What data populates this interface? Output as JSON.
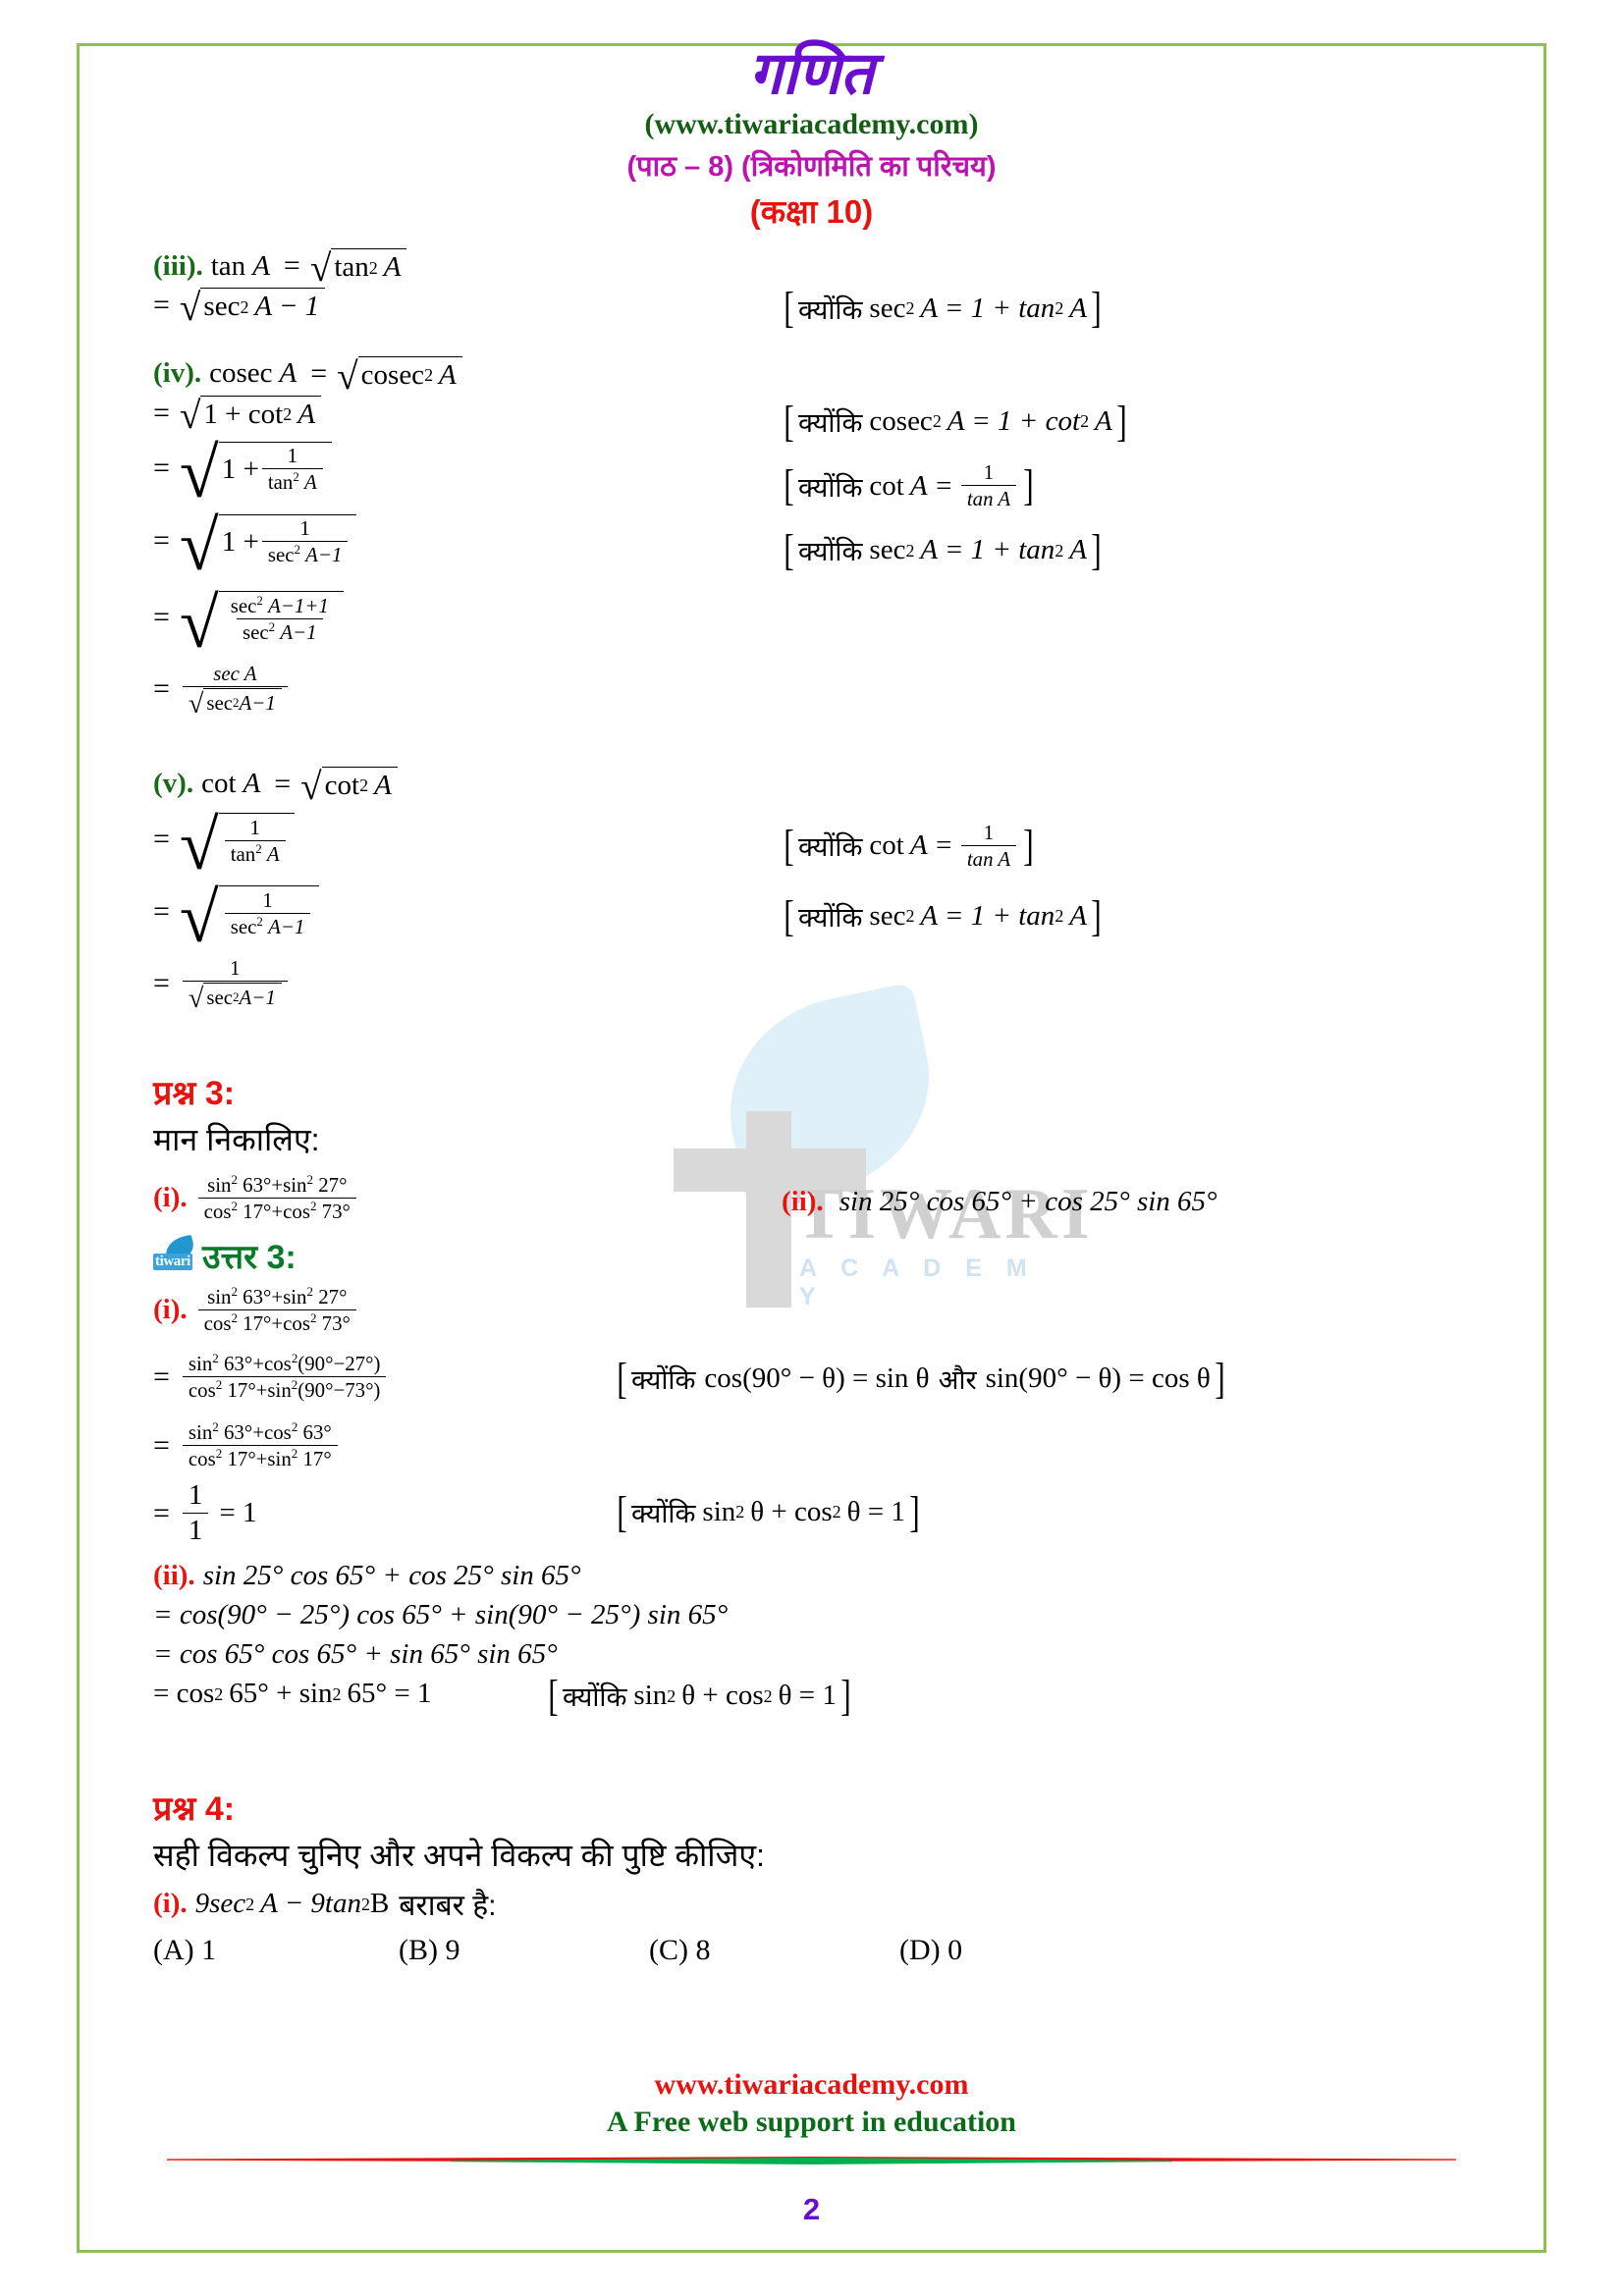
{
  "header": {
    "title": "गणित",
    "site": "(www.tiwariacademy.com)",
    "chapter": "(पाठ – 8) (त्रिकोणमिति का परिचय)",
    "klass": "(कक्षा 10)"
  },
  "watermark": {
    "word": "TIWARI",
    "sub": "A C A D E M Y"
  },
  "colors": {
    "title_purple": "#6a0dd0",
    "site_green": "#155d15",
    "chapter_magenta": "#bc13b0",
    "class_red": "#e8130f",
    "label_green": "#186a18",
    "answer_green": "#0a7a2a",
    "border_green": "#8cc152"
  },
  "part_iii": {
    "label": "(iii).",
    "line1_lhs": "tan",
    "line1_var": "A",
    "line1_eq": "=",
    "line1_rad_fn": "tan",
    "line1_rad_sup": "2",
    "line1_rad_var": "A",
    "line2_eq": "=",
    "line2_rad_fn": "sec",
    "line2_rad_sup": "2",
    "line2_rad_rest": "A − 1",
    "note": {
      "because": "क्योंकि",
      "fn": "sec",
      "sup": "2",
      "body": "A = 1 + tan",
      "sup2": "2",
      "tail": "A"
    }
  },
  "part_iv": {
    "label": "(iv).",
    "line1_lhs": "cosec",
    "line1_var": "A",
    "line1_eq": "=",
    "line1_rad_fn": "cosec",
    "line1_rad_sup": "2",
    "line1_rad_var": "A",
    "line2_eq": "=",
    "line2_radicand": "1 + cot",
    "line2_sup": "2",
    "line2_tail": "A",
    "line3_eq": "=",
    "line3_one": "1 +",
    "line3_num": "1",
    "line3_den_fn": "tan",
    "line3_den_sup": "2",
    "line3_den_var": "A",
    "line4_eq": "=",
    "line4_one": "1 +",
    "line4_num": "1",
    "line4_den_fn": "sec",
    "line4_den_sup": "2",
    "line4_den_rest": "A−1",
    "line5_eq": "=",
    "line5_num_fn": "sec",
    "line5_num_sup": "2",
    "line5_num_rest": "A−1+1",
    "line5_den_fn": "sec",
    "line5_den_sup": "2",
    "line5_den_rest": "A−1",
    "line6_eq": "=",
    "line6_num": "sec A",
    "line6_den_fn": "sec",
    "line6_den_sup": "2",
    "line6_den_rest": "A−1",
    "note1": {
      "because": "क्योंकि",
      "fn": "cosec",
      "sup": "2",
      "body": "A = 1 + cot",
      "sup2": "2",
      "tail": "A"
    },
    "note2": {
      "because": "क्योंकि",
      "fn": "cot",
      "body": "A =",
      "num": "1",
      "den": "tan A"
    },
    "note3": {
      "because": "क्योंकि",
      "fn": "sec",
      "sup": "2",
      "body": "A = 1 + tan",
      "sup2": "2",
      "tail": "A"
    }
  },
  "part_v": {
    "label": "(v).",
    "line1_lhs": "cot",
    "line1_var": "A",
    "line1_eq": "=",
    "line1_rad_fn": "cot",
    "line1_rad_sup": "2",
    "line1_rad_var": "A",
    "line2_eq": "=",
    "line2_num": "1",
    "line2_den_fn": "tan",
    "line2_den_sup": "2",
    "line2_den_var": "A",
    "line3_eq": "=",
    "line3_num": "1",
    "line3_den_fn": "sec",
    "line3_den_sup": "2",
    "line3_den_rest": "A−1",
    "line4_eq": "=",
    "line4_num": "1",
    "line4_den_fn": "sec",
    "line4_den_sup": "2",
    "line4_den_rest": "A−1",
    "note1": {
      "because": "क्योंकि",
      "fn": "cot",
      "body": "A =",
      "num": "1",
      "den": "tan A"
    },
    "note2": {
      "because": "क्योंकि",
      "fn": "sec",
      "sup": "2",
      "body": "A = 1 + tan",
      "sup2": "2",
      "tail": "A"
    }
  },
  "question3": {
    "heading": "प्रश्न 3:",
    "prompt": "मान निकालिए:",
    "i_label": "(i).",
    "i_num": "sin",
    "i_num_sup": "2",
    "i_num_a": "63°+sin",
    "i_num_sup2": "2",
    "i_num_b": "27°",
    "i_den": "cos",
    "i_den_sup": "2",
    "i_den_a": "17°+cos",
    "i_den_sup2": "2",
    "i_den_b": "73°",
    "ii_label": "(ii).",
    "ii_text": "sin 25° cos 65° + cos 25° sin 65°"
  },
  "answer3": {
    "heading": "उत्तर 3:",
    "i_label": "(i).",
    "step1_num": "sin",
    "step1_num_sup": "2",
    "step1_num_a": "63°+sin",
    "step1_num_sup2": "2",
    "step1_num_b": "27°",
    "step1_den": "cos",
    "step1_den_sup": "2",
    "step1_den_a": "17°+cos",
    "step1_den_sup2": "2",
    "step1_den_b": "73°",
    "step2_eq": "=",
    "step2_num": "sin",
    "step2_num_sup": "2",
    "step2_num_a": "63°+cos",
    "step2_num_sup2": "2",
    "step2_num_b": "(90°−27°)",
    "step2_den": "cos",
    "step2_den_sup": "2",
    "step2_den_a": "17°+sin",
    "step2_den_sup2": "2",
    "step2_den_b": "(90°−73°)",
    "step3_eq": "=",
    "step3_num": "sin",
    "step3_num_sup": "2",
    "step3_num_a": "63°+cos",
    "step3_num_sup2": "2",
    "step3_num_b": "63°",
    "step3_den": "cos",
    "step3_den_sup": "2",
    "step3_den_a": "17°+sin",
    "step3_den_sup2": "2",
    "step3_den_b": "17°",
    "step4_eq": "=",
    "step4_num": "1",
    "step4_den": "1",
    "step4_tail": "= 1",
    "note_a": {
      "because": "क्योंकि",
      "body1": "cos(90° − θ) = sin θ",
      "and": "और",
      "body2": "sin(90° − θ) = cos θ"
    },
    "note_b": {
      "because": "क्योंकि",
      "fn": "sin",
      "sup": "2",
      "mid": "θ + cos",
      "sup2": "2",
      "tail": "θ = 1"
    },
    "ii_label": "(ii).",
    "ii_line1": "sin 25° cos 65° + cos 25° sin 65°",
    "ii_line2": "= cos(90° − 25°) cos 65° + sin(90° − 25°) sin 65°",
    "ii_line3": "= cos 65° cos 65° + sin 65° sin 65°",
    "ii_line4_a": "= cos",
    "ii_line4_sup": "2",
    "ii_line4_b": "65° + sin",
    "ii_line4_sup2": "2",
    "ii_line4_c": "65° = 1"
  },
  "question4": {
    "heading": "प्रश्न 4:",
    "prompt": "सही विकल्प चुनिए और अपने विकल्प की पुष्टि कीजिए:",
    "i_label": "(i).",
    "i_a": "9sec",
    "i_sup": "2",
    "i_b": "A − 9tan",
    "i_sup2": "2",
    "i_c": "B",
    "i_tail": "बराबर है:",
    "options": [
      "(A) 1",
      "(B) 9",
      "(C) 8",
      "(D) 0"
    ]
  },
  "footer": {
    "url": "www.tiwariacademy.com",
    "tagline": "A Free web support in education",
    "page_number": "2"
  }
}
